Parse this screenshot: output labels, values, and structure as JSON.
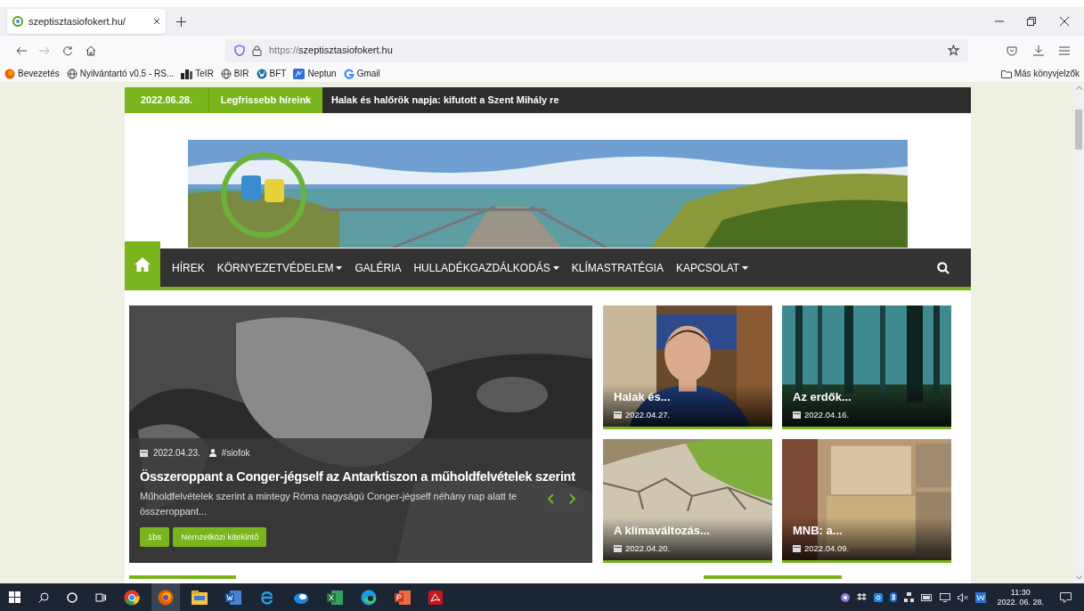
{
  "browser": {
    "tab": {
      "title": "szeptisztasiofokert.hu/",
      "selected": true
    },
    "address": {
      "scheme": "https://",
      "host": "szeptisztasiofokert.hu"
    },
    "bookmarks": [
      {
        "label": "Bevezetés",
        "kind": "firefox"
      },
      {
        "label": "Nyilvántartó v0.5 - RS...",
        "kind": "globe"
      },
      {
        "label": "TeIR",
        "kind": "tower"
      },
      {
        "label": "BIR",
        "kind": "globe"
      },
      {
        "label": "BFT",
        "kind": "wordpress"
      },
      {
        "label": "Neptun",
        "kind": "neptun"
      },
      {
        "label": "Gmail",
        "kind": "google"
      }
    ],
    "other_bookmarks": "Más könyvjelzők"
  },
  "ticker": {
    "date": "2022.06.28.",
    "label": "Legfrissebb híreink",
    "headline": "Halak és halőrök napja: kifutott a Szent Mihály re"
  },
  "nav": {
    "items": [
      {
        "label": "HÍREK",
        "has_menu": false
      },
      {
        "label": "KÖRNYEZETVÉDELEM",
        "has_menu": true
      },
      {
        "label": "GALÉRIA",
        "has_menu": false
      },
      {
        "label": "HULLADÉKGAZDÁLKODÁS",
        "has_menu": true
      },
      {
        "label": "KLÍMASTRATÉGIA",
        "has_menu": false
      },
      {
        "label": "KAPCSOLAT",
        "has_menu": true
      }
    ]
  },
  "hero": {
    "date": "2022.04.23.",
    "author": "#siofok",
    "title": "Összeroppant a Conger-jégself az Antarktiszon a műholdfelvételek szerint",
    "excerpt": "Műholdfelvételek szerint a mintegy Róma nagyságú Conger-jégself néhány nap alatt te",
    "excerpt_end": "összeroppant...",
    "tags": [
      "1bs",
      "Nemzetközi kitekintő"
    ]
  },
  "cards": [
    {
      "title": "Halak és...",
      "date": "2022.04.27.",
      "kind": "person"
    },
    {
      "title": "Az erdők...",
      "date": "2022.04.16.",
      "kind": "forest"
    },
    {
      "title": "A klímaváltozás...",
      "date": "2022.04.20.",
      "kind": "drought"
    },
    {
      "title": "MNB: a...",
      "date": "2022.04.09.",
      "kind": "building"
    }
  ],
  "taskbar": {
    "time": "11:30",
    "date": "2022. 06. 28."
  }
}
